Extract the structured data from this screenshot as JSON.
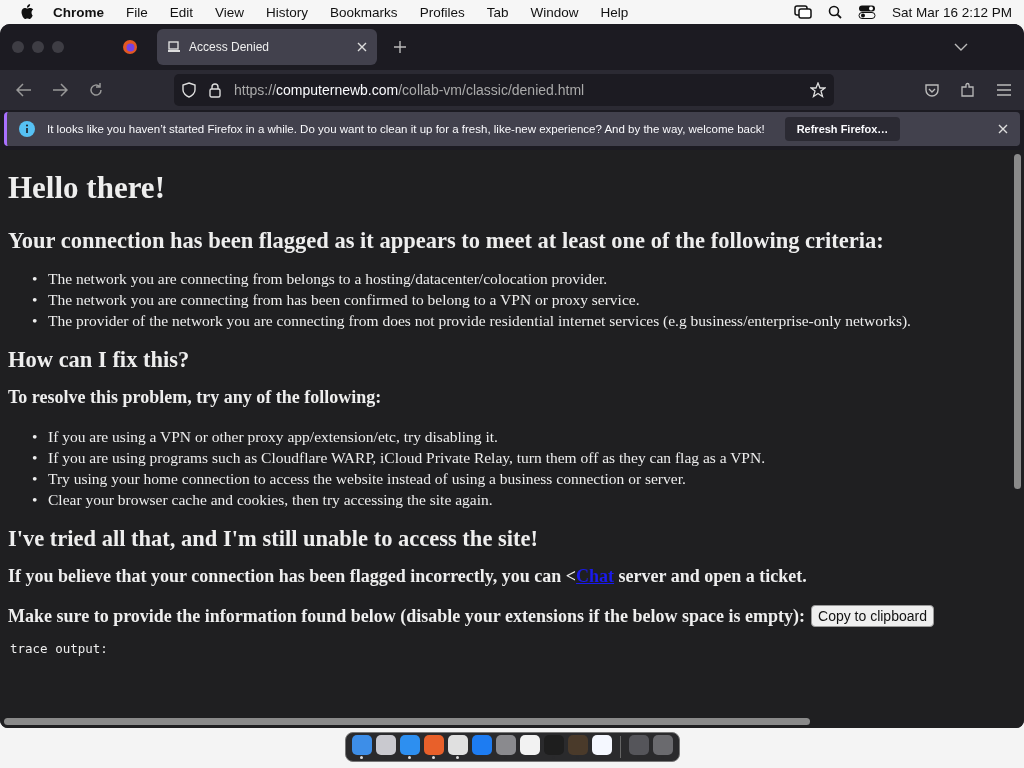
{
  "menubar": {
    "app": "Chrome",
    "items": [
      "File",
      "Edit",
      "View",
      "History",
      "Bookmarks",
      "Profiles",
      "Tab",
      "Window",
      "Help"
    ],
    "clock": "Sat Mar 16  2:12 PM"
  },
  "tabs": [
    {
      "label": "Access Denied",
      "selected": true
    }
  ],
  "address": {
    "scheme": "https://",
    "domain": "computernewb.com",
    "path": "/collab-vm/classic/denied.html"
  },
  "notification": {
    "message": "It looks like you haven’t started Firefox in a while. Do you want to clean it up for a fresh, like-new experience? And by the way, welcome back!",
    "button": "Refresh Firefox…"
  },
  "page": {
    "title": "Hello there!",
    "criteria_heading": "Your connection has been flagged as it appears to meet at least one of the following criteria:",
    "criteria": [
      {
        "marker": "•",
        "text": "The network you are connecting from belongs to a hosting/datacenter/colocation provider."
      },
      {
        "marker": "•",
        "text": "The network you are connecting from has been confirmed to belong to a VPN or proxy service."
      },
      {
        "marker": "•",
        "text": "The provider of the network you are connecting from does not provide residential internet services (e.g business/enterprise-only networks)."
      }
    ],
    "fix_heading": "How can I fix this?",
    "resolve_heading": "To resolve this problem, try any of the following:",
    "fixes": [
      {
        "marker": "•",
        "text": "If you are using a VPN or other proxy app/extension/etc, try disabling it."
      },
      {
        "marker": "•",
        "text": "If you are using programs such as Cloudflare WARP, iCloud Private Relay, turn them off as they can flag as a VPN."
      },
      {
        "marker": "•",
        "text": "Try using your home connection to access the website instead of using a business connection or server."
      },
      {
        "marker": "•",
        "text": "Clear your browser cache and cookies, then try accessing the site again."
      }
    ],
    "tried_heading": "I've tried all that, and I'm still unable to access the site!",
    "contact_before": "If you believe that your connection has been flagged incorrectly, you can <",
    "contact_link": "Chat",
    "contact_after": " server and open a ticket.",
    "info_text": "Make sure to provide the information found below (disable your extensions if the below space is empty):",
    "copy_button": "Copy to clipboard",
    "trace": "trace output:"
  },
  "dock": [
    {
      "kind": "finder",
      "running": true
    },
    {
      "kind": "launchpad",
      "running": false
    },
    {
      "kind": "safari",
      "running": true
    },
    {
      "kind": "firefox",
      "running": true
    },
    {
      "kind": "chrome",
      "running": true
    },
    {
      "kind": "appstore",
      "running": false
    },
    {
      "kind": "settings",
      "running": false
    },
    {
      "kind": "notes",
      "running": false
    },
    {
      "kind": "terminal",
      "running": false
    },
    {
      "kind": "brush",
      "running": false
    },
    {
      "kind": "vscode",
      "running": false
    },
    {
      "kind": "divider"
    },
    {
      "kind": "window",
      "running": false
    },
    {
      "kind": "trash",
      "running": false
    }
  ]
}
